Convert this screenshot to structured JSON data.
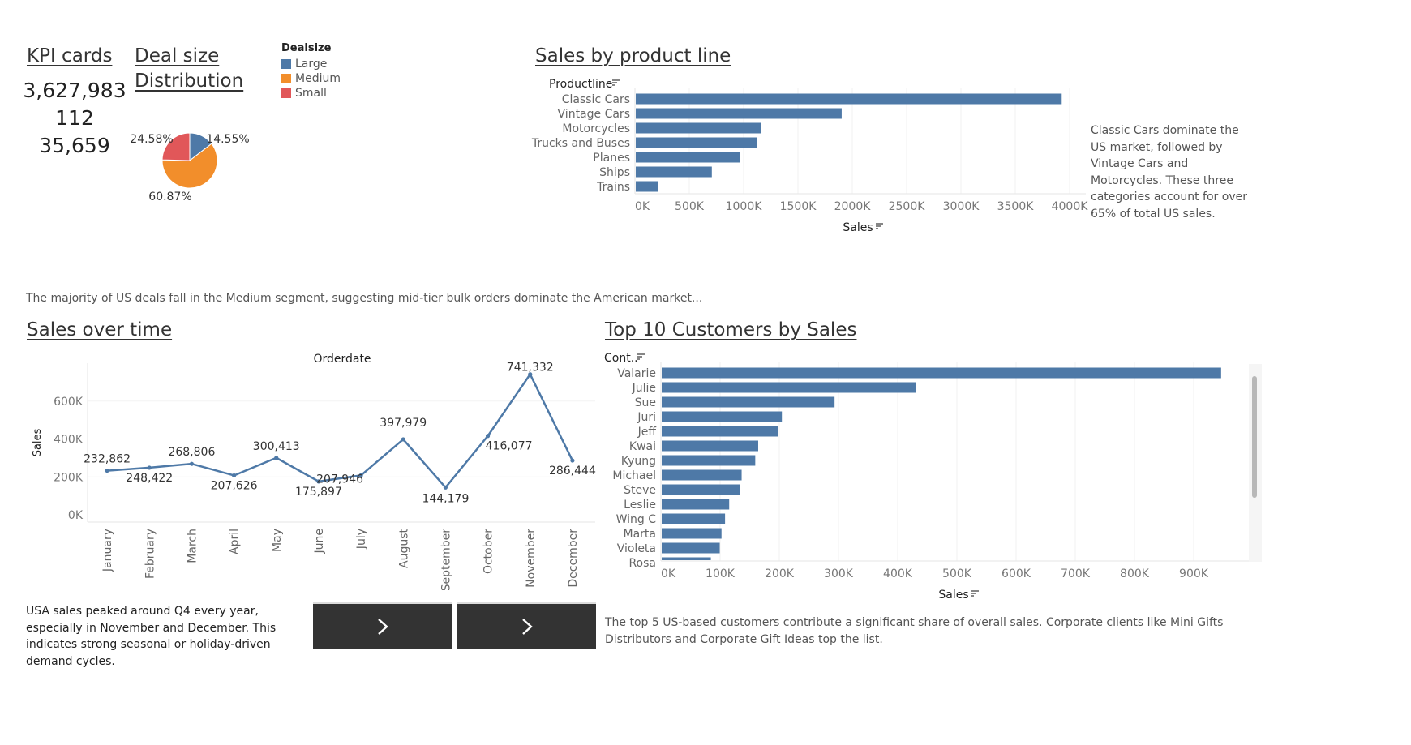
{
  "headings": {
    "kpi": "KPI cards",
    "deal_size_1": "Deal size",
    "deal_size_2": "Distribution",
    "product": "Sales by product line",
    "time": "Sales over time",
    "customers": "Top 10 Customers by Sales"
  },
  "kpi_values": [
    "3,627,983",
    "112",
    "35,659"
  ],
  "notes": {
    "product": "Classic Cars dominate the US market, followed by Vintage Cars and Motorcycles. These three categories account for over 65% of total US sales.",
    "deal": "The majority of US deals fall in the Medium segment, suggesting mid-tier bulk orders dominate the American market...",
    "time": "USA sales peaked around Q4 every year, especially in November and December. This indicates strong seasonal or holiday-driven demand cycles.",
    "customers": "The top 5 US-based customers contribute a significant share of overall sales. Corporate clients like Mini Gifts Distributors and Corporate Gift Ideas top the list."
  },
  "buttons": {
    "prev": "›",
    "next": "›"
  },
  "colors": {
    "blue": "#4e79a7",
    "orange": "#f28e2b",
    "red": "#e15759"
  },
  "chart_data": [
    {
      "id": "deal_pie",
      "type": "pie",
      "legend_title": "Dealsize",
      "legend": [
        {
          "name": "Large",
          "color": "#4e79a7"
        },
        {
          "name": "Medium",
          "color": "#f28e2b"
        },
        {
          "name": "Small",
          "color": "#e15759"
        }
      ],
      "slices": [
        {
          "name": "Large",
          "value": 14.55,
          "label": "14.55%",
          "color": "#4e79a7"
        },
        {
          "name": "Medium",
          "value": 60.87,
          "label": "60.87%",
          "color": "#f28e2b"
        },
        {
          "name": "Small",
          "value": 24.58,
          "label": "24.58%",
          "color": "#e15759"
        }
      ]
    },
    {
      "id": "product_bar",
      "type": "bar",
      "orientation": "horizontal",
      "category_label": "Productline",
      "xlabel": "Sales",
      "categories": [
        "Classic Cars",
        "Vintage Cars",
        "Motorcycles",
        "Trucks and Buses",
        "Planes",
        "Ships",
        "Trains"
      ],
      "values": [
        3920000,
        1895000,
        1155000,
        1115000,
        960000,
        700000,
        205000
      ],
      "xlim": [
        0,
        4000000
      ],
      "ticks": [
        0,
        500000,
        1000000,
        1500000,
        2000000,
        2500000,
        3000000,
        3500000,
        4000000
      ],
      "tick_labels": [
        "0K",
        "500K",
        "1000K",
        "1500K",
        "2000K",
        "2500K",
        "3000K",
        "3500K",
        "4000K"
      ]
    },
    {
      "id": "time_line",
      "type": "line",
      "title": "Orderdate",
      "ylabel": "Sales",
      "categories": [
        "January",
        "February",
        "March",
        "April",
        "May",
        "June",
        "July",
        "August",
        "September",
        "October",
        "November",
        "December"
      ],
      "values": [
        232862,
        248422,
        268806,
        207626,
        300413,
        175897,
        207946,
        397979,
        144179,
        416077,
        741332,
        286444
      ],
      "labels": [
        "232,862",
        "248,422",
        "268,806",
        "207,626",
        "300,413",
        "175,897",
        "207,946",
        "397,979",
        "144,179",
        "416,077",
        "741,332",
        "286,444"
      ],
      "ylim": [
        0,
        800000
      ],
      "ticks": [
        0,
        200000,
        400000,
        600000
      ],
      "tick_labels": [
        "0K",
        "200K",
        "400K",
        "600K"
      ]
    },
    {
      "id": "customer_bar",
      "type": "bar",
      "orientation": "horizontal",
      "category_label": "Cont..",
      "xlabel": "Sales",
      "categories": [
        "Valarie",
        "Julie",
        "Sue",
        "Juri",
        "Jeff",
        "Kwai",
        "Kyung",
        "Michael",
        "Steve",
        "Leslie",
        "Wing C",
        "Marta",
        "Violeta",
        "Rosa"
      ],
      "values": [
        945000,
        430000,
        292000,
        203000,
        197000,
        163000,
        158000,
        135000,
        132000,
        114000,
        107000,
        101000,
        98000,
        83000
      ],
      "xlim": [
        0,
        1000000
      ],
      "ticks": [
        0,
        100000,
        200000,
        300000,
        400000,
        500000,
        600000,
        700000,
        800000,
        900000
      ],
      "tick_labels": [
        "0K",
        "100K",
        "200K",
        "300K",
        "400K",
        "500K",
        "600K",
        "700K",
        "800K",
        "900K"
      ]
    }
  ]
}
